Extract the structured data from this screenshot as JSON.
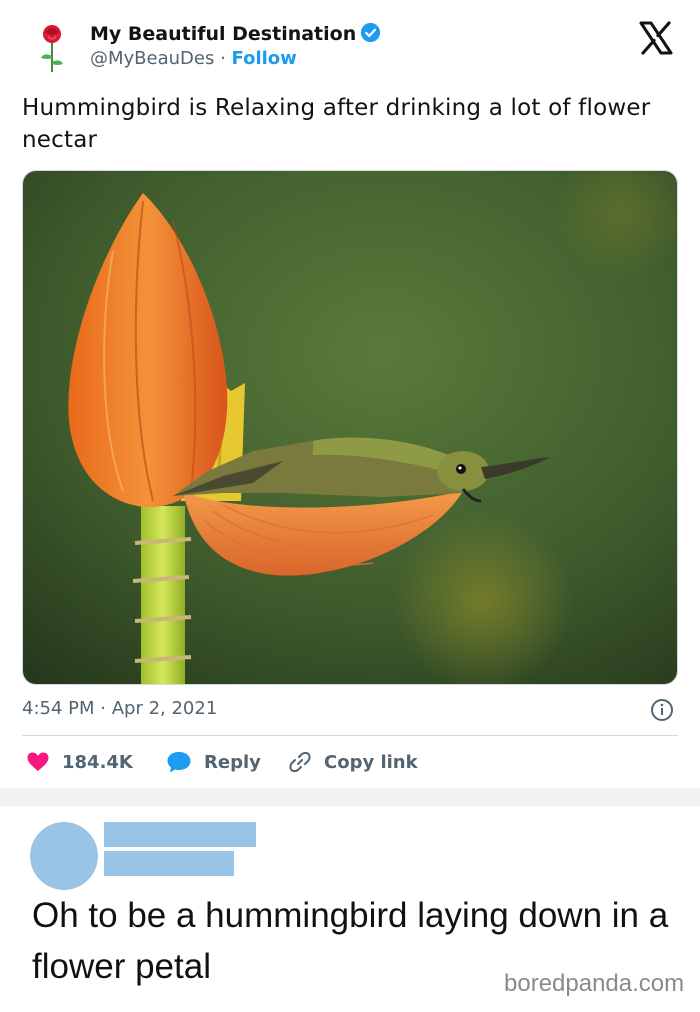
{
  "account": {
    "display_name": "My Beautiful Destination",
    "handle": "@MyBeauDes",
    "separator": " · ",
    "follow_label": "Follow"
  },
  "tweet": {
    "text": "Hummingbird is Relaxing after drinking a lot of flower nectar",
    "image_alt": "Hummingbird lying on an orange flower petal",
    "time": "4:54 PM",
    "date": "Apr 2, 2021",
    "time_separator": " · "
  },
  "actions": {
    "likes": "184.4K",
    "reply_label": "Reply",
    "copy_label": "Copy link"
  },
  "comment": {
    "text": "Oh to be a hummingbird laying down in a flower petal"
  },
  "watermark": "boredpanda.com",
  "colors": {
    "accent": "#1d9bf0",
    "like": "#f91880",
    "secondary_text": "#536471",
    "redacted": "#99c4e6"
  }
}
